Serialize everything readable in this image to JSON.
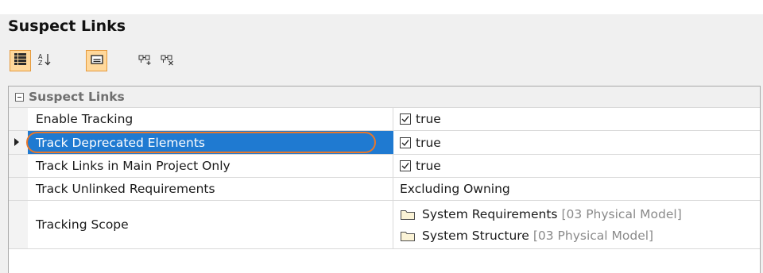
{
  "panel": {
    "title": "Suspect Links"
  },
  "toolbar": {
    "buttons": [
      {
        "icon": "categorized-view-icon",
        "active": true
      },
      {
        "icon": "sort-alphabetical-icon",
        "active": false
      },
      {
        "icon": "show-description-icon",
        "active": true
      },
      {
        "icon": "expand-all-icon",
        "active": false
      },
      {
        "icon": "collapse-all-icon",
        "active": false
      }
    ]
  },
  "group": {
    "label": "Suspect Links",
    "expanded": true
  },
  "properties": [
    {
      "name": "Enable Tracking",
      "type": "checkbox",
      "checked": true,
      "value": "true"
    },
    {
      "name": "Track Deprecated Elements",
      "type": "checkbox",
      "checked": true,
      "value": "true",
      "selected": true
    },
    {
      "name": "Track Links in Main Project Only",
      "type": "checkbox",
      "checked": true,
      "value": "true"
    },
    {
      "name": "Track Unlinked Requirements",
      "type": "text",
      "value": "Excluding Owning"
    },
    {
      "name": "Tracking Scope",
      "type": "list",
      "items": [
        {
          "name": "System Requirements",
          "owner": "[03 Physical Model]"
        },
        {
          "name": "System Structure",
          "owner": "[03 Physical Model]"
        }
      ]
    }
  ],
  "colors": {
    "selection": "#1f7ad1",
    "highlight": "#e8772a",
    "toolbar_active": "#ffd89b"
  }
}
